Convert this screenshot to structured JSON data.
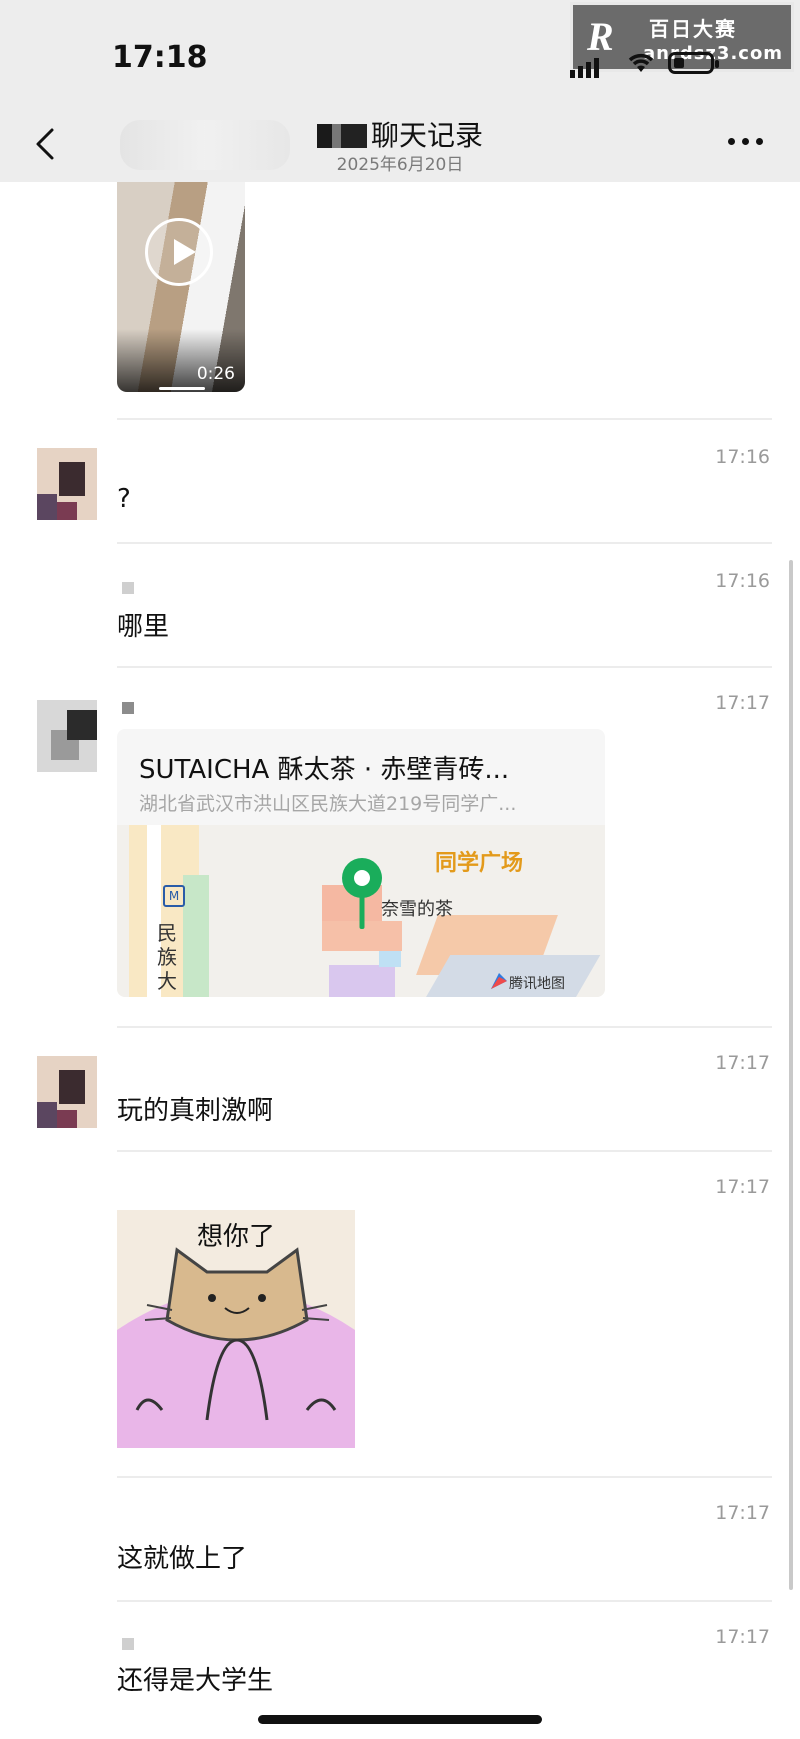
{
  "status_bar": {
    "time": "17:18",
    "watermark_logo": "R",
    "watermark_title": "百日大赛",
    "watermark_url": "anrdsz3.com"
  },
  "nav": {
    "title": "聊天记录",
    "date": "2025年6月20日"
  },
  "messages": [
    {
      "type": "video",
      "duration": "0:26"
    },
    {
      "type": "text",
      "time": "17:16",
      "text": "?"
    },
    {
      "type": "text",
      "time": "17:16",
      "text": "哪里"
    },
    {
      "type": "location",
      "time": "17:17",
      "title": "SUTAICHA 酥太茶 · 赤壁青砖...",
      "address": "湖北省武汉市洪山区民族大道219号同学广...",
      "map_label": "同学广场",
      "poi": "奈雪的茶",
      "road": "民族大",
      "brand": "腾讯地图"
    },
    {
      "type": "text",
      "time": "17:17",
      "text": "玩的真刺激啊"
    },
    {
      "type": "sticker",
      "time": "17:17",
      "sticker_text": "想你了"
    },
    {
      "type": "text",
      "time": "17:17",
      "text": "这就做上了"
    },
    {
      "type": "text",
      "time": "17:17",
      "text": "还得是大学生"
    }
  ],
  "colors": {
    "header_bg": "#ededed",
    "pin_green": "#1aad5b",
    "label_orange": "#e39a1b"
  }
}
